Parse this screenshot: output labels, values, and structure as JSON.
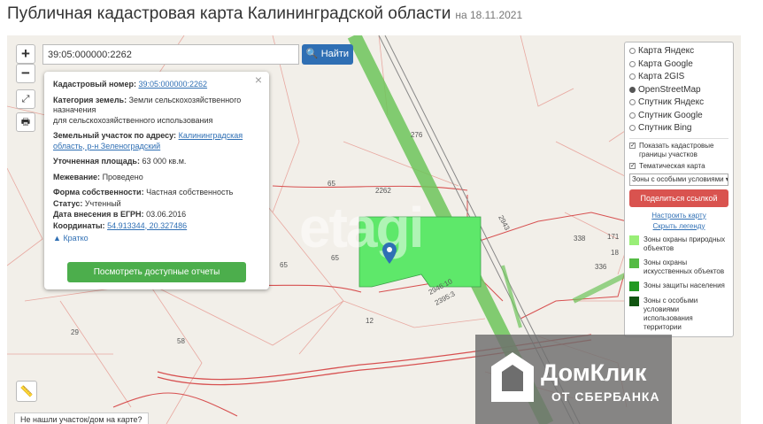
{
  "header": {
    "title": "Публичная кадастровая карта Калининградской области",
    "date": "на 18.11.2021"
  },
  "controls": {
    "zoom_in": "+",
    "zoom_out": "−",
    "search_value": "39:05:000000:2262",
    "find_label": "Найти"
  },
  "popup": {
    "cad_num_label": "Кадастровый номер:",
    "cad_num_value": "39:05:000000:2262",
    "category_label": "Категория земель:",
    "category_value": "Земли сельскохозяйственного назначения",
    "category_value2": "для сельскохозяйственного использования",
    "address_label": "Земельный участок по адресу:",
    "address_value": "Калининградская область, р-н Зеленоградский",
    "area_label": "Уточненная площадь:",
    "area_value": "63 000 кв.м.",
    "survey_label": "Межевание:",
    "survey_value": "Проведено",
    "ownership_label": "Форма собственности:",
    "ownership_value": "Частная собственность",
    "status_label": "Статус:",
    "status_value": "Учтенный",
    "egrn_label": "Дата внесения в ЕГРН:",
    "egrn_value": "03.06.2016",
    "coords_label": "Координаты:",
    "coords_value": "54.913344, 20.327486",
    "brief_label": "Кратко",
    "reports_button": "Посмотреть доступные отчеты"
  },
  "layers": {
    "basemaps": [
      {
        "label": "Карта Яндекс",
        "selected": false
      },
      {
        "label": "Карта Google",
        "selected": false
      },
      {
        "label": "Карта 2GIS",
        "selected": false
      },
      {
        "label": "OpenStreetMap",
        "selected": true
      },
      {
        "label": "Спутник Яндекс",
        "selected": false
      },
      {
        "label": "Спутник Google",
        "selected": false
      },
      {
        "label": "Спутник Bing",
        "selected": false
      }
    ],
    "show_borders": "Показать кадастровые границы участков",
    "thematic": "Тематическая карта",
    "zones_select": "Зоны с особыми условиями",
    "share_button": "Поделиться ссылкой",
    "configure_link": "Настроить карту",
    "hide_legend_link": "Скрыть легенду",
    "legend": [
      {
        "label": "Зоны охраны природных объектов",
        "color": "#99ee77"
      },
      {
        "label": "Зоны охраны искусственных объектов",
        "color": "#55bb44"
      },
      {
        "label": "Зоны защиты населения",
        "color": "#229922"
      },
      {
        "label": "Зоны с особыми условиями использования территории",
        "color": "#115511"
      }
    ]
  },
  "map_labels": {
    "l276": "276",
    "l2262": "2262",
    "l65a": "65",
    "l65b": "65",
    "l65c": "65",
    "l12": "12",
    "l29": "29",
    "l58": "58",
    "l336": "336",
    "l338": "338",
    "l171": "171",
    "l18": "18",
    "l2943": "2943",
    "l2946": "2946:10",
    "l2395": "2395:3"
  },
  "not_found": "Не нашли участок/дом на карте?",
  "watermark": "etagi",
  "ad": {
    "name": "ДомКлик",
    "sub": "ОТ СБЕРБАНКА"
  },
  "colors": {
    "parcel": "#5ee86a",
    "road": "#6dc45a",
    "accent_blue": "#2f6fb4",
    "report_green": "#4cae4c",
    "share_red": "#d9534f"
  }
}
